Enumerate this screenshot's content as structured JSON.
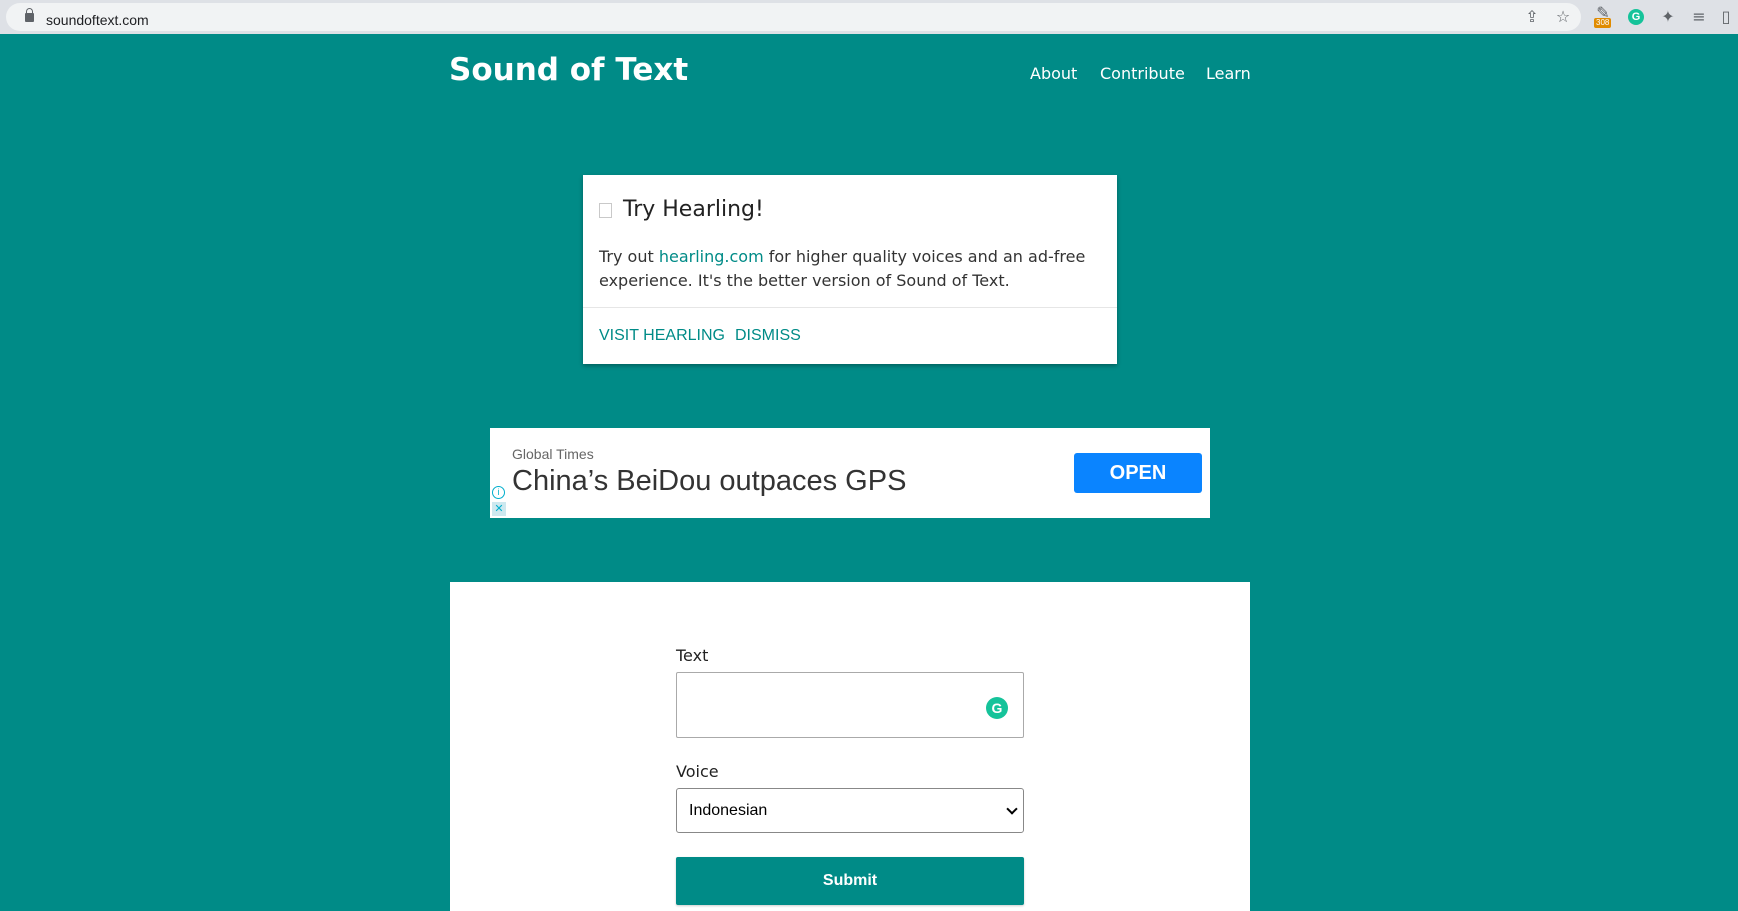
{
  "browser": {
    "url": "soundoftext.com",
    "extension_badge": "308",
    "grammarly_glyph": "G",
    "icons": [
      "lock-icon",
      "share-icon",
      "star-icon",
      "extension-icon",
      "grammarly-icon",
      "puzzle-icon",
      "reading-list-icon",
      "side-panel-icon"
    ]
  },
  "header": {
    "title": "Sound of Text",
    "nav": [
      "About",
      "Contribute",
      "Learn"
    ]
  },
  "card": {
    "title": "Try Hearling!",
    "body_prefix": "Try out ",
    "body_link": "hearling.com",
    "body_suffix": " for higher quality voices and an ad-free experience. It's the better version of Sound of Text.",
    "actions": [
      "VISIT HEARLING",
      "DISMISS"
    ]
  },
  "ad": {
    "source": "Global Times",
    "headline": "China’s BeiDou outpaces GPS",
    "cta": "OPEN",
    "info_glyph": "i",
    "close_glyph": "✕"
  },
  "form": {
    "text_label": "Text",
    "text_value": "",
    "grammarly_glyph": "G",
    "voice_label": "Voice",
    "voice_selected": "Indonesian",
    "submit_label": "Submit"
  },
  "colors": {
    "brand": "#008b87",
    "link": "#008b87",
    "ad_button": "#0a84ff",
    "grammarly": "#15c39a"
  }
}
